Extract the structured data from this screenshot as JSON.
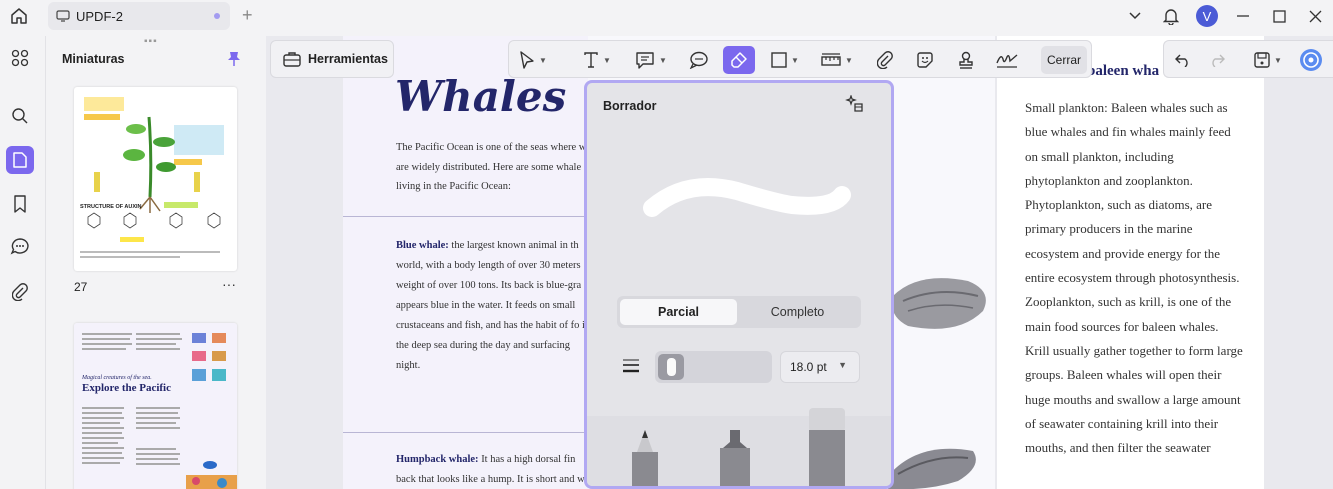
{
  "topbar": {
    "tab_title": "UPDF-2",
    "avatar_letter": "V"
  },
  "sidebar": {
    "title": "Miniaturas",
    "page_number": "27",
    "more": "···",
    "thumb2_subtitle": "Magical creatures of the sea.",
    "thumb2_title": "Explore the Pacific",
    "thumb1_heading": "STRUCTURE OF AUXIN"
  },
  "tools_button": "Herramientas",
  "toolbar": {
    "close_label": "Cerrar"
  },
  "eraser_panel": {
    "title": "Borrador",
    "options": [
      "Parcial",
      "Completo"
    ],
    "selected": "Parcial",
    "size_value": "18.0 pt"
  },
  "document": {
    "title": "Whales",
    "intro": "The Pacific Ocean is one of the seas where w are widely distributed. Here are some whale living in the Pacific Ocean:",
    "blue_whale_label": "Blue whale:",
    "blue_whale_text": " the largest known animal in th world, with a body length of over 30 meters weight of over 100 tons. Its back is blue-gra appears blue in the water. It feeds on small crustaceans and fish, and has the habit of fo in the deep sea during the day and surfacing night.",
    "humpback_label": "Humpback whale:",
    "humpback_text": " It has a high dorsal fin back that looks like a hump. It is short and w",
    "right_heading": "baleen wha",
    "right_body": "Small plankton: Baleen whales such as blue whales and fin whales mainly feed on small plankton, including phytoplankton and zooplankton. Phytoplankton, such as diatoms, are primary producers in the marine ecosystem and provide energy for the entire ecosystem through photosynthesis. Zooplankton, such as krill, is one of the main food sources for baleen whales. Krill usually gather together to form large groups. Baleen whales will open their huge mouths and swallow a large amount of seawater containing krill into their mouths, and then filter the seawater"
  },
  "colors": {
    "accent": "#7b68ee",
    "popup_border": "#b1a8f2",
    "title_navy": "#23266a"
  }
}
